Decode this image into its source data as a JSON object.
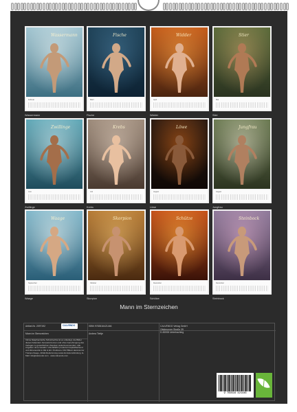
{
  "calendar_title": "Mann im Sternzeichen",
  "signs": [
    {
      "caption": "Wassermann",
      "script": "Wassermann",
      "strip_month": "Februar"
    },
    {
      "caption": "Fische",
      "script": "Fische",
      "strip_month": "März"
    },
    {
      "caption": "Widder",
      "script": "Widder",
      "strip_month": "April"
    },
    {
      "caption": "Stier",
      "script": "Stier",
      "strip_month": "Mai"
    },
    {
      "caption": "Zwillinge",
      "script": "Zwillinge",
      "strip_month": "Juni"
    },
    {
      "caption": "Krebs",
      "script": "Krebs",
      "strip_month": "Juli"
    },
    {
      "caption": "Löwe",
      "script": "Löwe",
      "strip_month": "August"
    },
    {
      "caption": "Jungfrau",
      "script": "Jungfrau",
      "strip_month": "August"
    },
    {
      "caption": "Waage",
      "script": "Waage",
      "strip_month": "September"
    },
    {
      "caption": "Skorpion",
      "script": "Skorpion",
      "strip_month": "Oktober"
    },
    {
      "caption": "Schütze",
      "script": "Schütze",
      "strip_month": "Dezember"
    },
    {
      "caption": "Steinbock",
      "script": "Steinbock",
      "strip_month": "Dezember"
    }
  ],
  "info": {
    "artikel": "Artikel-Nr. 2097192",
    "title_small": "Mann im Sternzeichen",
    "isbn": "ISBN 9783516421446",
    "author": "Andrea Tiettje",
    "publisher": [
      "CALVENDO Verlag GmbH",
      "Ottobrunner Straße 39",
      "D-82008 Unterhaching"
    ],
    "logo": "CALVENDO",
    "description": "Intime blasphemische Schutzrechte ist es unbefugt, die Bilder dieses Kalenders herauszutrennen und ohne Genehmigung des Verlages zu gewerblichen Zwecken weiterzuverwenden. Alle Angaben ohne Gewähr. CALVENDO produziert kapitelflachend und klimaneutral in DE & EU. Positivere CO2 Bilanz dank kurzer Transportwege, Abfall-Reduzierung sowie Emissionsbindung. E-Mail: info@calvendo.com · www.calvendo.com",
    "barcode_digits": "9 783516 421446"
  },
  "colors": {
    "sheet": "#2b2b2b",
    "caption_text": "#d6d6d6",
    "eco_green": "#69b53a"
  }
}
